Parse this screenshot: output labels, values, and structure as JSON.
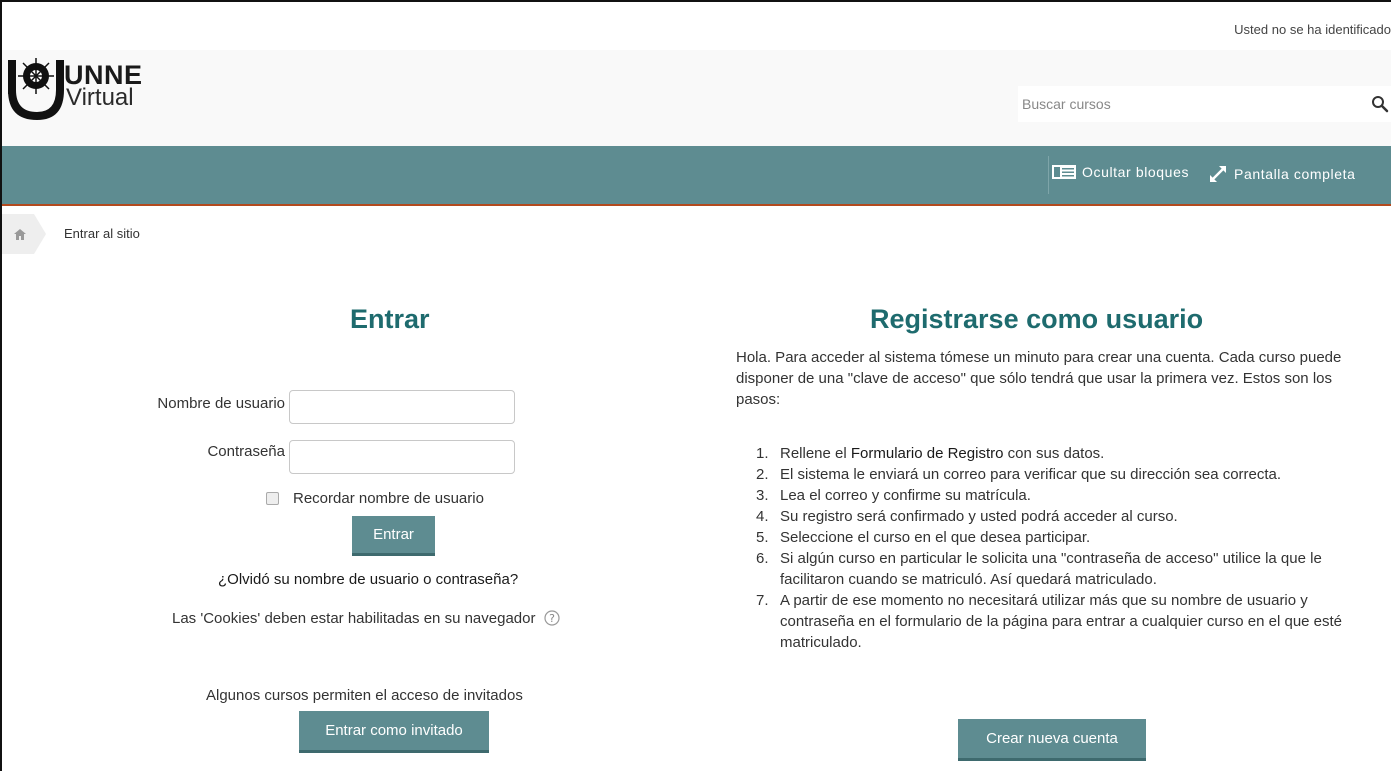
{
  "header": {
    "login_info": "Usted no se ha identificado",
    "logo": {
      "line1": "UNNE",
      "line2": "Virtual"
    },
    "search": {
      "placeholder": "Buscar cursos",
      "icon": "search-icon"
    }
  },
  "navbar": {
    "hide_blocks": {
      "label": "Ocultar bloques",
      "icon": "blocks-icon"
    },
    "fullscreen": {
      "label": "Pantalla completa",
      "icon": "expand-icon"
    }
  },
  "breadcrumb": {
    "home_icon": "home-icon",
    "current": "Entrar al sitio"
  },
  "login": {
    "title": "Entrar",
    "username_label": "Nombre de usuario",
    "username_value": "",
    "password_label": "Contraseña",
    "password_value": "",
    "remember_label": "Recordar nombre de usuario",
    "remember_checked": false,
    "submit_label": "Entrar",
    "forgot_link": "¿Olvidó su nombre de usuario o contraseña?",
    "cookies_text": "Las 'Cookies' deben estar habilitadas en su navegador",
    "help_icon": "help-icon",
    "guests_text": "Algunos cursos permiten el acceso de invitados",
    "guest_button": "Entrar como invitado"
  },
  "signup": {
    "title": "Registrarse como usuario",
    "intro": "Hola. Para acceder al sistema tómese un minuto para crear una cuenta. Cada curso puede disponer de una \"clave de acceso\" que sólo tendrá que usar la primera vez. Estos son los pasos:",
    "step1_before": "Rellene el ",
    "step1_link": "Formulario de Registro",
    "step1_after": " con sus datos.",
    "steps": [
      {
        "num": "1.",
        "text": ""
      },
      {
        "num": "2.",
        "text": "El sistema le enviará un correo para verificar que su dirección sea correcta."
      },
      {
        "num": "3.",
        "text": "Lea el correo y confirme su matrícula."
      },
      {
        "num": "4.",
        "text": "Su registro será confirmado y usted podrá acceder al curso."
      },
      {
        "num": "5.",
        "text": "Seleccione el curso en el que desea participar."
      },
      {
        "num": "6.",
        "text": "Si algún curso en particular le solicita una \"contraseña de acceso\" utilice la que le facilitaron cuando se matriculó. Así quedará matriculado."
      },
      {
        "num": "7.",
        "text": "A partir de ese momento no necesitará utilizar más que su nombre de usuario y contraseña en el formulario de la página para entrar a cualquier curso en el que esté matriculado."
      }
    ],
    "create_button": "Crear nueva cuenta"
  },
  "colors": {
    "accent": "#5e8c91",
    "heading": "#1e6b6e",
    "nav_border": "#b34a1e"
  }
}
